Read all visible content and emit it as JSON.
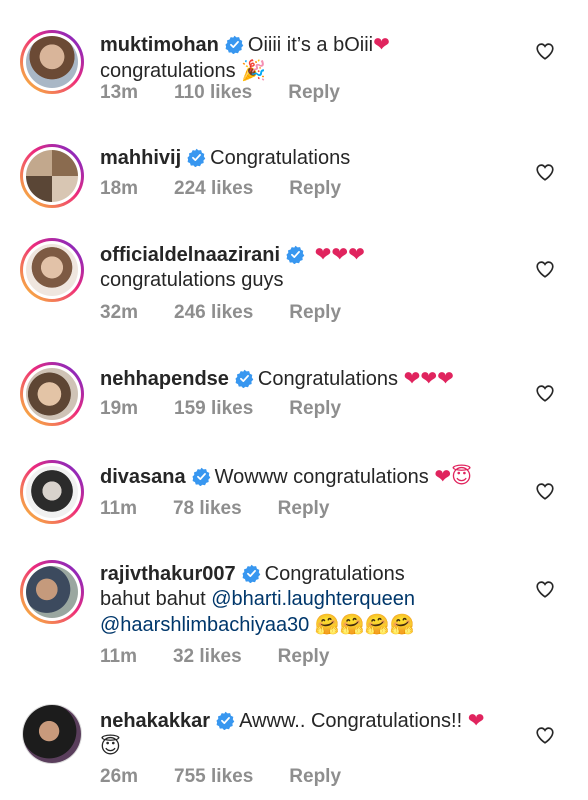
{
  "comments": [
    {
      "username": "muktimohan",
      "text": "Oiiii it’s a bOiii",
      "text2": "congratulations",
      "emoji": "❤",
      "emoji2": "🎉",
      "time": "13m",
      "likes": "110 likes",
      "reply": "Reply"
    },
    {
      "username": "mahhivij",
      "text": "Congratulations",
      "time": "18m",
      "likes": "224 likes",
      "reply": "Reply"
    },
    {
      "username": "officialdelnaazirani",
      "emoji": "❤❤❤",
      "text2": "congratulations guys",
      "time": "32m",
      "likes": "246 likes",
      "reply": "Reply"
    },
    {
      "username": "nehhapendse",
      "text": "Congratulations",
      "emoji": "❤❤❤",
      "time": "19m",
      "likes": "159 likes",
      "reply": "Reply"
    },
    {
      "username": "divasana",
      "text": "Wowww congratulations",
      "emoji": "❤😇",
      "time": "11m",
      "likes": "78 likes",
      "reply": "Reply"
    },
    {
      "username": "rajivthakur007",
      "text": "Congratulations",
      "text2": "bahut bahut",
      "mention1": "@bharti.laughterqueen",
      "mention2": "@haarshlimbachiyaa30",
      "emoji2": "🤗🤗🤗🤗",
      "time": "11m",
      "likes": "32 likes",
      "reply": "Reply"
    },
    {
      "username": "nehakakkar",
      "text": "Awww.. Congratulations!!",
      "emoji": "❤",
      "emoji2": "😇",
      "time": "26m",
      "likes": "755 likes",
      "reply": "Reply"
    }
  ],
  "colors": {
    "verified": "#3897f0",
    "heart": "#e0245e",
    "meta": "#8e8e8e",
    "mention": "#00376b"
  },
  "icons": {
    "verified": "verified-badge-icon",
    "like": "heart-outline-icon"
  }
}
